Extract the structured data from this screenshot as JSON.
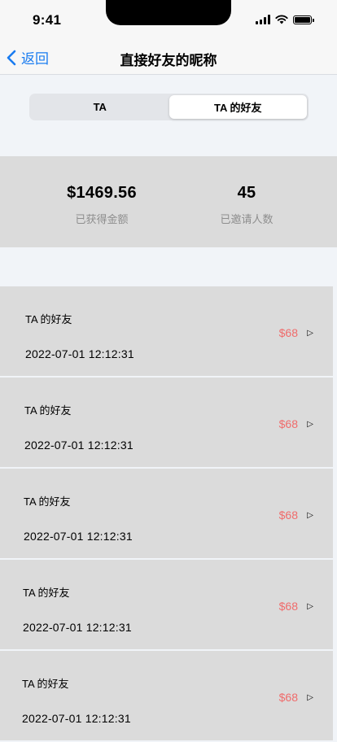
{
  "status_bar": {
    "time": "9:41"
  },
  "nav": {
    "back_label": "返回",
    "title": "直接好友的昵称"
  },
  "segment": {
    "tabs": [
      {
        "label": "TA",
        "active": false
      },
      {
        "label": "TA 的好友",
        "active": true
      }
    ]
  },
  "summary": {
    "earned": {
      "value": "$1469.56",
      "label": "已获得金额"
    },
    "invited": {
      "value": "45",
      "label": "已邀请人数"
    }
  },
  "friends": [
    {
      "name": "TA 的好友",
      "date": "2022-07-01 12:12:31",
      "amount": "$68"
    },
    {
      "name": "TA 的好友",
      "date": "2022-07-01 12:12:31",
      "amount": "$68"
    },
    {
      "name": "TA 的好友",
      "date": "2022-07-01 12:12:31",
      "amount": "$68"
    },
    {
      "name": "TA 的好友",
      "date": "2022-07-01 12:12:31",
      "amount": "$68"
    },
    {
      "name": "TA 的好友",
      "date": "2022-07-01 12:12:31",
      "amount": "$68"
    }
  ],
  "colors": {
    "accent": "#1a7cf0",
    "amount": "#f06b6b",
    "panel": "#dbdbdb",
    "background": "#f1f4f8"
  },
  "icons": {
    "back": "chevron-left-icon",
    "row_arrow": "play-triangle-icon",
    "signal": "cellular-signal-icon",
    "wifi": "wifi-icon",
    "battery": "battery-icon"
  }
}
